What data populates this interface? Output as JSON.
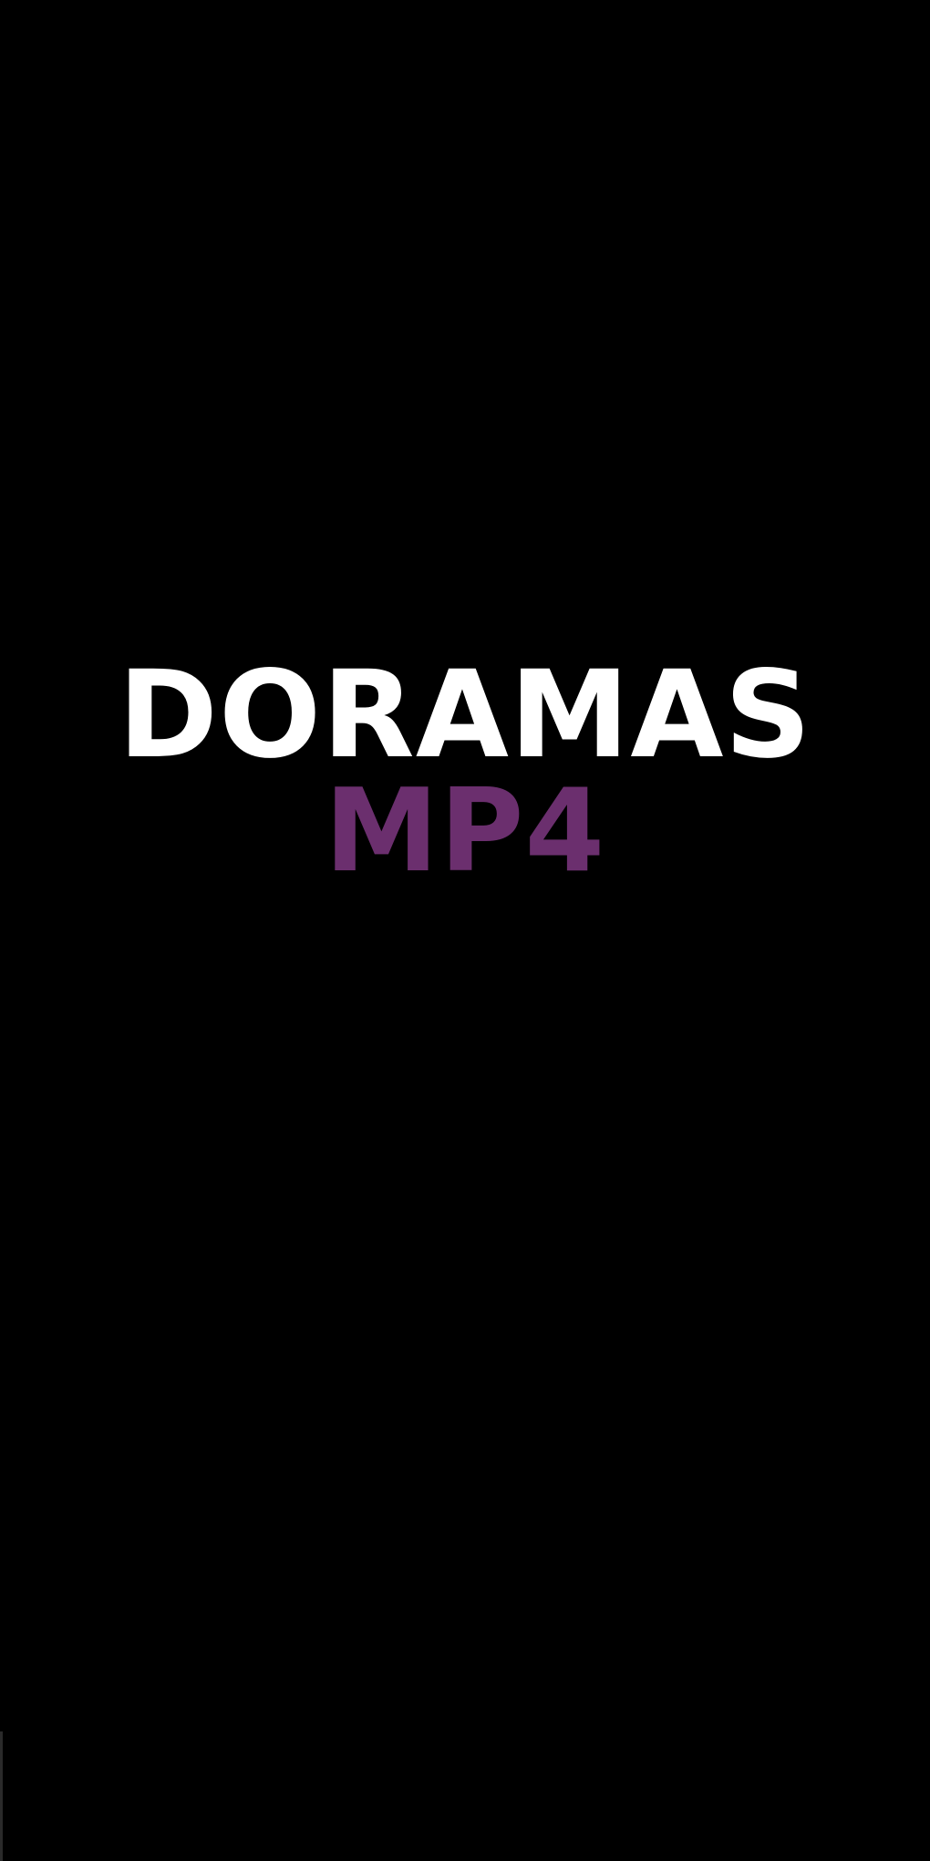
{
  "app": {
    "logo": {
      "line1": "DORAMAS",
      "line2": "MP4",
      "line1_color": "#ffffff",
      "line2_color": "#6b2f6e"
    },
    "background_color": "#000000"
  }
}
